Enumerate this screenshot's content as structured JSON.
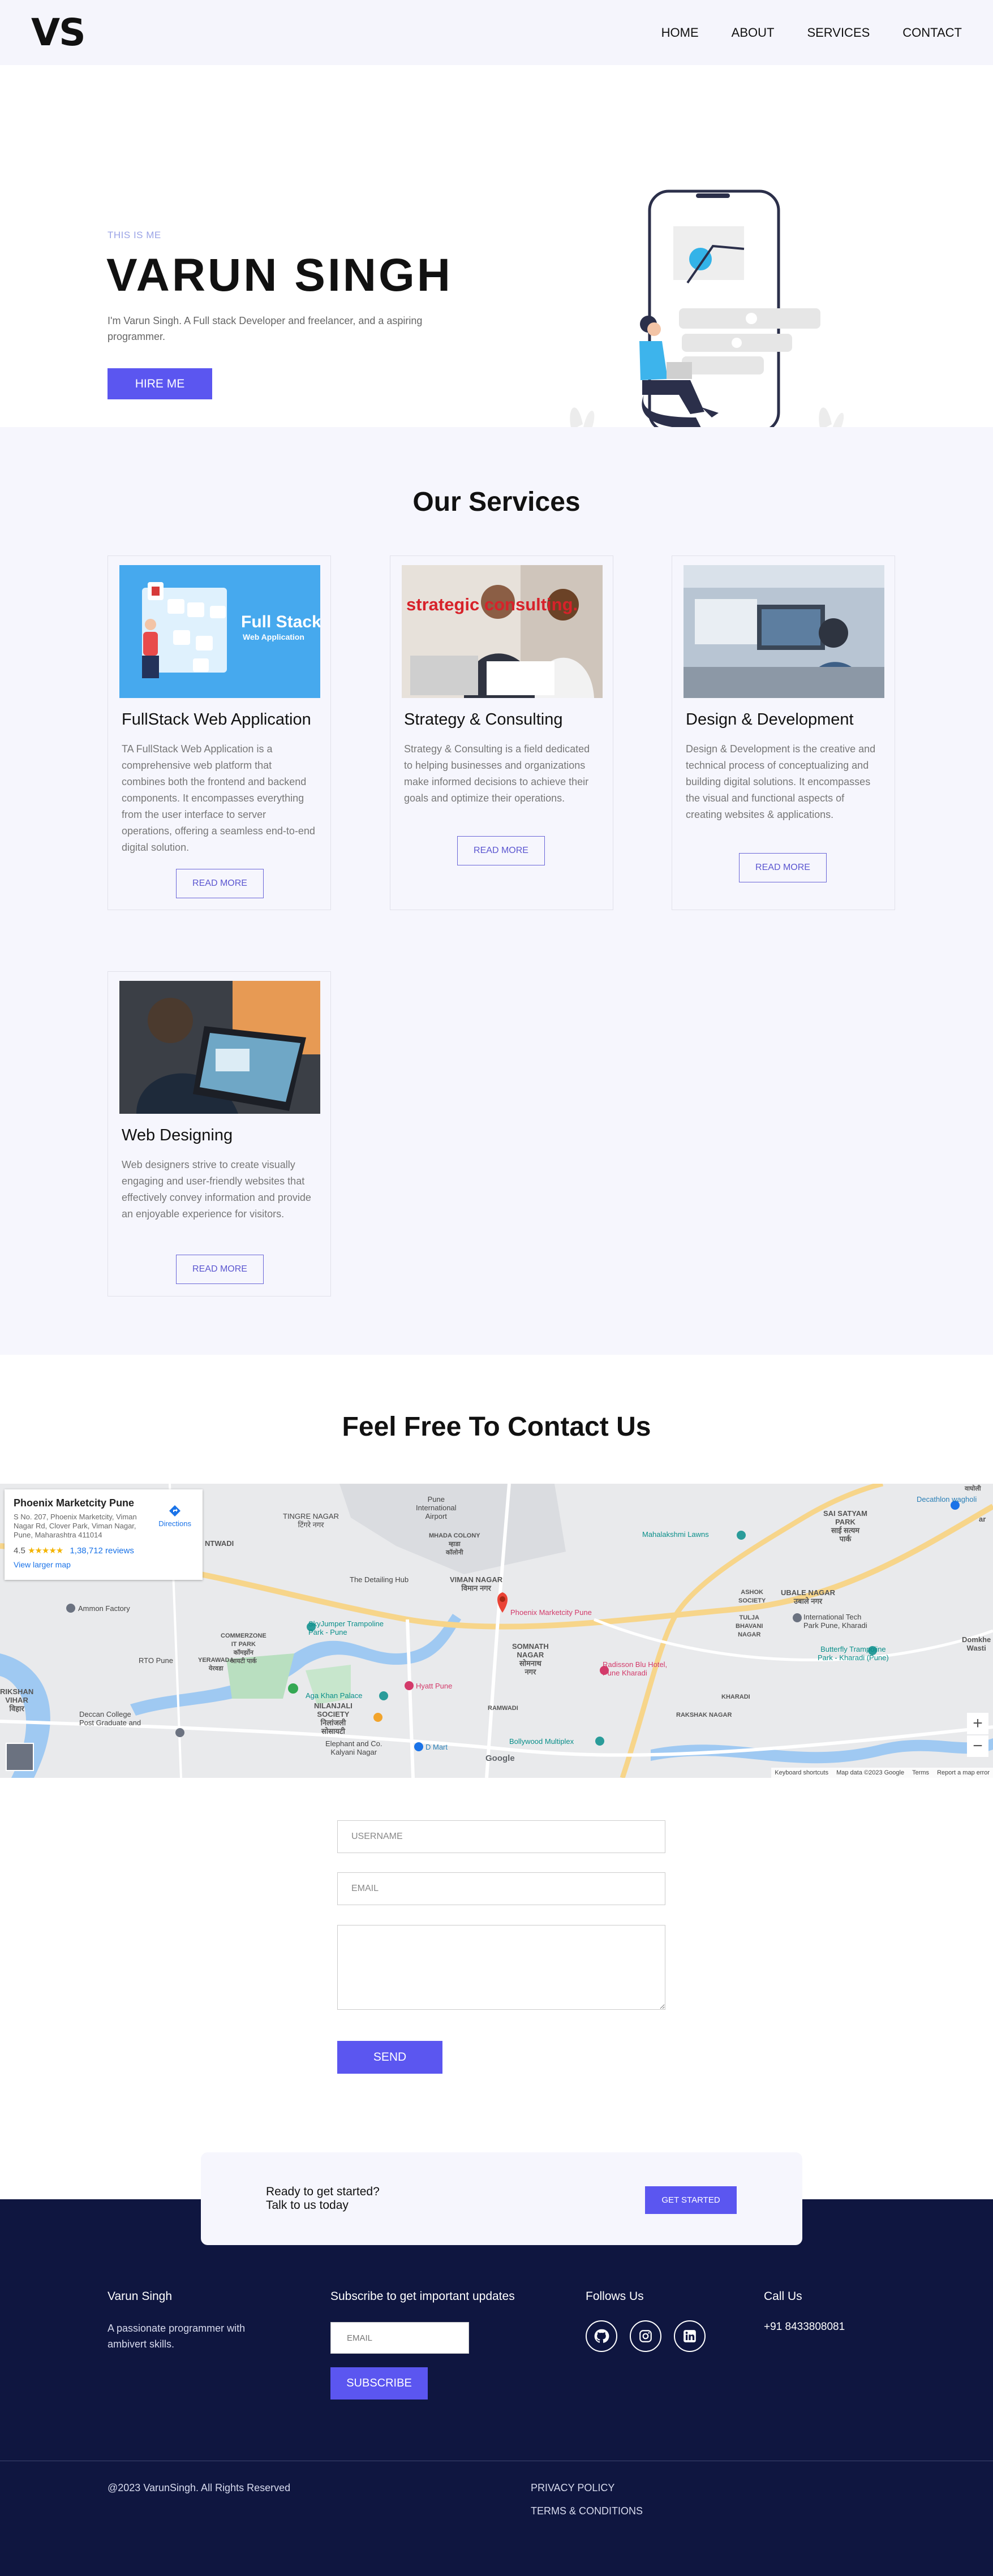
{
  "header": {
    "logo": "VS",
    "nav": [
      "HOME",
      "ABOUT",
      "SERVICES",
      "CONTACT"
    ]
  },
  "hero": {
    "eyebrow": "THIS IS ME",
    "name": "VARUN SINGH",
    "description": "I'm Varun Singh. A Full stack Developer and freelancer, and a aspiring programmer.",
    "cta": "HIRE ME"
  },
  "services": {
    "title": "Our Services",
    "cards": [
      {
        "title": "FullStack Web Application",
        "description": "TA FullStack Web Application is a comprehensive web platform that combines both the frontend and backend components. It encompasses everything from the user interface to server operations, offering a seamless end-to-end digital solution.",
        "button": "READ MORE",
        "image_text": "Full Stack",
        "image_subtext": "Web Application"
      },
      {
        "title": "Strategy & Consulting",
        "description": "Strategy & Consulting is a field dedicated to helping businesses and organizations make informed decisions to achieve their goals and optimize their operations.",
        "button": "READ MORE",
        "image_text": "strategic consulting."
      },
      {
        "title": "Design & Development",
        "description": "Design & Development is the creative and technical process of conceptualizing and building digital solutions. It encompasses the visual and functional aspects of creating websites & applications.",
        "button": "READ MORE"
      },
      {
        "title": "Web Designing",
        "description": "Web designers strive to create visually engaging and user-friendly websites that effectively convey information and provide an enjoyable experience for visitors.",
        "button": "READ MORE"
      }
    ]
  },
  "contact": {
    "title": "Feel Free To Contact Us",
    "map": {
      "place_name": "Phoenix Marketcity Pune",
      "address": "S No. 207, Phoenix Marketcity, Viman Nagar Rd, Clover Park, Viman Nagar, Pune, Maharashtra 411014",
      "rating": "4.5",
      "stars": "★★★★★",
      "reviews": "1,38,712 reviews",
      "directions": "Directions",
      "larger_map": "View larger map",
      "labels": {
        "tingre": "TINGRE NAGAR\nटिंगरे नगर",
        "airport": "Pune\nInternational\nAirport",
        "mhada": "MHADA COLONY\nम्हाडा\nकॉलोनी",
        "viman": "VIMAN NAGAR\nविमान नगर",
        "detailing": "The Detailing Hub",
        "phoenix_pin": "Phoenix Marketcity Pune",
        "somnath": "SOMNATH\nNAGAR\nसोमनाथ\nनगर",
        "skyjumper": "SkyJumper Trampoline\nPark - Pune",
        "commerz": "COMMERZONE\nIT PARK\nकॉमर्झोन\nआयटी पार्क",
        "ammon": "Ammon Factory",
        "rto": "RTO Pune",
        "yerawada": "YERAWADA\nयेरवडा",
        "aga": "Aga Khan Palace",
        "hyatt": "Hyatt Pune",
        "nilanjali": "NILANJALI\nSOCIETY\nनिलांजली\nसोसायटी",
        "deccan": "Deccan College\nPost Graduate and",
        "elephant": "Elephant and Co.\nKalyani Nagar",
        "dmart": "D Mart",
        "bollywood": "Bollywood Multiplex",
        "radisson": "Radisson Blu Hotel,\nPune Kharadi",
        "ubale": "UBALE NAGAR\nउबाले नगर",
        "sai": "SAI SATYAM\nPARK\nसाई सत्यम\nपार्क",
        "decathlon": "Decathlon wagholi",
        "mahalakshmi": "Mahalakshmi Lawns",
        "itp": "International Tech\nPark Pune, Kharadi",
        "butterfly": "Butterfly Trampoline\nPark - Kharadi (Pune)",
        "raksha": "RAKSHAK NAGAR",
        "kharadi": "KHARADI",
        "tulja": "TULJA\nBHAVANI\nNAGAR",
        "ashok": "ASHOK\nSOCIETY",
        "rikshan": "RIKSHAN\nVIHAR\nविहार",
        "domkhel": "Domkhe\nWasti",
        "ramwadi": "RAMWADI",
        "shantiwadi": "NTWADI",
        "wagholi_top": "वाघोली",
        "hosp": "ar"
      },
      "footer_items": [
        "Keyboard shortcuts",
        "Map data ©2023 Google",
        "Terms",
        "Report a map error"
      ],
      "google": "Google"
    },
    "form": {
      "username_placeholder": "USERNAME",
      "email_placeholder": "EMAIL",
      "send": "SEND"
    }
  },
  "cta": {
    "line1": "Ready to get started?",
    "line2": "Talk to us today",
    "button": "GET STARTED"
  },
  "footer": {
    "name": "Varun Singh",
    "tagline": "A passionate programmer with ambivert skills.",
    "subscribe_title": "Subscribe to get important updates",
    "email_placeholder": "EMAIL",
    "subscribe_button": "SUBSCRIBE",
    "follow_title": "Follows Us",
    "call_title": "Call Us",
    "phone": "+91 8433808081",
    "copyright": "@2023 VarunSingh. All Rights Reserved",
    "privacy": "PRIVACY POLICY",
    "terms": "TERMS & CONDITIONS"
  },
  "colors": {
    "accent": "#5b56f0",
    "footer_bg": "#0f1640",
    "section_bg": "#f6f6fd"
  }
}
